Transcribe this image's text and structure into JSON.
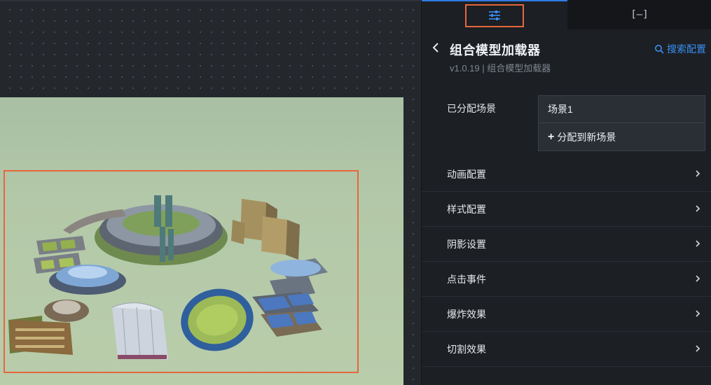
{
  "tabs": {
    "config_icon": "sliders-icon",
    "layers_icon": "bracket-icon",
    "layers_label": "[–]"
  },
  "header": {
    "title": "组合模型加载器",
    "subtitle": "v1.0.19 | 组合模型加载器",
    "search_label": "搜索配置"
  },
  "scene": {
    "label": "已分配场景",
    "current": "场景1",
    "add_label": "分配到新场景"
  },
  "sections": [
    {
      "label": "动画配置"
    },
    {
      "label": "样式配置"
    },
    {
      "label": "阴影设置"
    },
    {
      "label": "点击事件"
    },
    {
      "label": "爆炸效果"
    },
    {
      "label": "切割效果"
    }
  ],
  "colors": {
    "accent": "#3a8ff3",
    "highlight": "#e5673d",
    "panel_bg": "#1c1f24",
    "canvas_bg": "#24272c"
  }
}
